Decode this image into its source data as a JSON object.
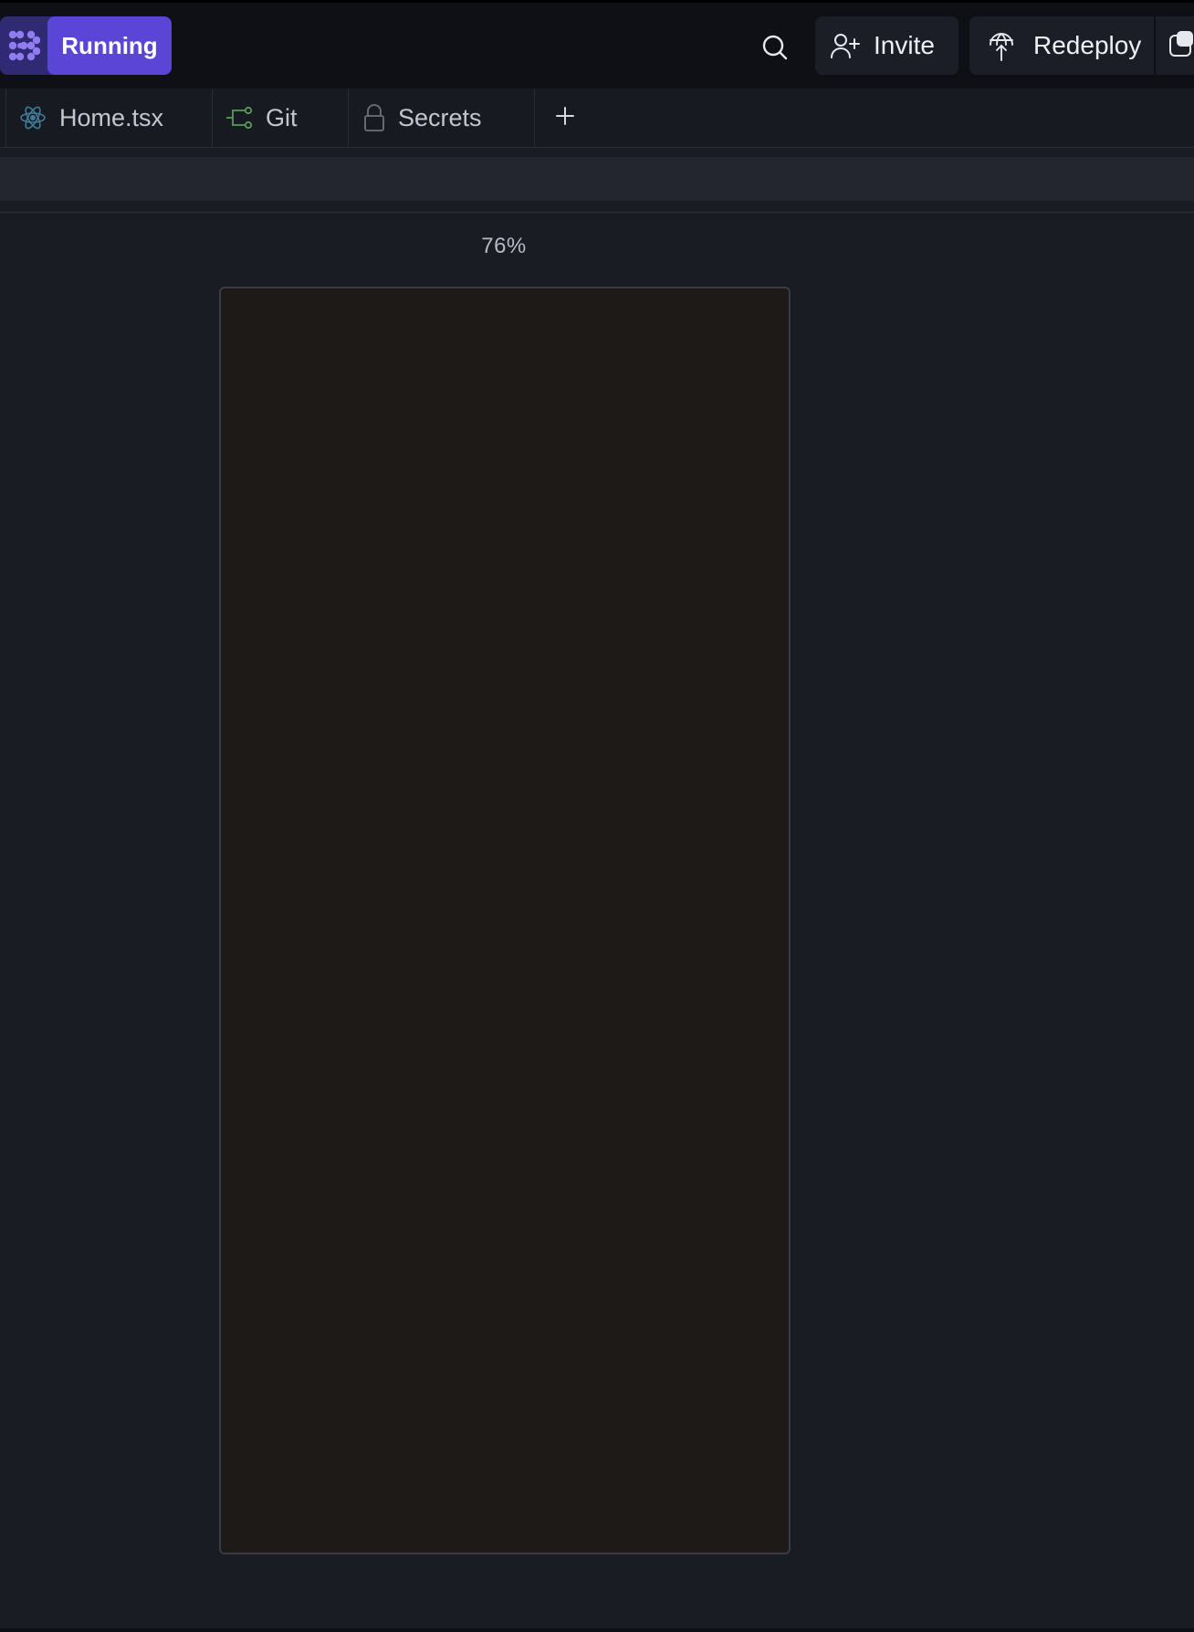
{
  "topbar": {
    "run_label": "Running",
    "invite_label": "Invite",
    "redeploy_label": "Redeploy",
    "icons": {
      "logo": "replit-logo-icon",
      "search": "search-icon",
      "invite": "add-user-icon",
      "redeploy": "globe-upload-icon",
      "extra": "window-icon"
    }
  },
  "tabs": [
    {
      "label": "Home.tsx",
      "icon": "react-icon"
    },
    {
      "label": "Git",
      "icon": "git-branch-icon"
    },
    {
      "label": "Secrets",
      "icon": "lock-icon"
    }
  ],
  "tab_add_icon": "plus-icon",
  "preview": {
    "zoom": "76%"
  },
  "colors": {
    "accent": "#5a45d6",
    "accent_dark": "#2f2a73",
    "background": "#1a1c24",
    "topbar": "#0e1016",
    "preview_bg": "#1e1a18"
  }
}
